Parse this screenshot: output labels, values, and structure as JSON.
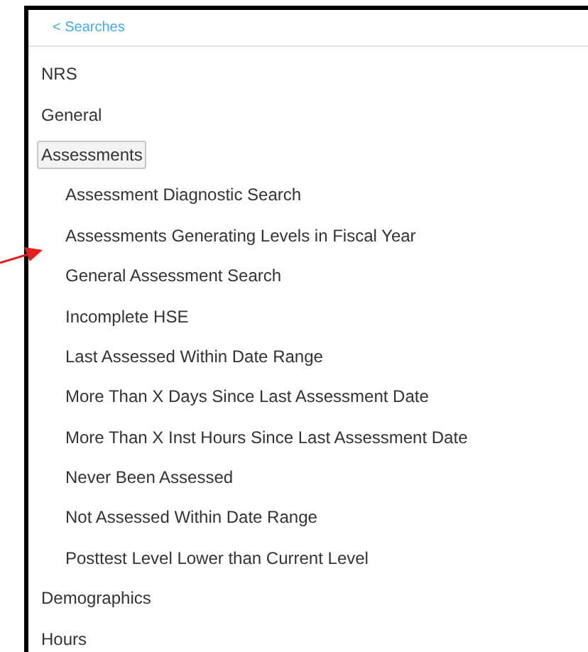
{
  "back_link": "< Searches",
  "categories": [
    {
      "label": "NRS",
      "selected": false
    },
    {
      "label": "General",
      "selected": false
    },
    {
      "label": "Assessments",
      "selected": true,
      "children": [
        {
          "label": "Assessment Diagnostic Search",
          "selected": false
        },
        {
          "label": "Assessments Generating Levels in Fiscal Year",
          "selected": false
        },
        {
          "label": "General Assessment Search",
          "selected": false
        },
        {
          "label": "Incomplete HSE",
          "selected": false
        },
        {
          "label": "Last Assessed Within Date Range",
          "selected": false
        },
        {
          "label": "More Than X Days Since Last Assessment Date",
          "selected": false
        },
        {
          "label": "More Than X Inst Hours Since Last Assessment Date",
          "selected": false
        },
        {
          "label": "Never Been Assessed",
          "selected": false
        },
        {
          "label": "Not Assessed Within Date Range",
          "selected": false
        },
        {
          "label": "Posttest Level Lower than Current Level",
          "selected": false
        }
      ]
    },
    {
      "label": "Demographics",
      "selected": false
    },
    {
      "label": "Hours",
      "selected": false
    }
  ]
}
